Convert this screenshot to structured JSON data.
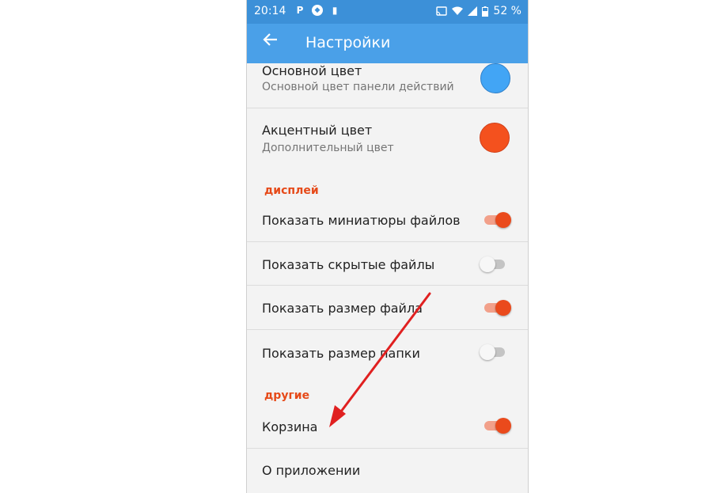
{
  "status_bar": {
    "time": "20:14",
    "left_icons": [
      "parking-icon",
      "compass-icon",
      "trash-icon"
    ],
    "right_icons": [
      "cast-icon",
      "wifi-icon",
      "signal-icon",
      "battery-icon"
    ],
    "battery": "52 %"
  },
  "toolbar": {
    "back_icon": "arrow-left-icon",
    "title": "Настройки"
  },
  "settings": {
    "primary_color": {
      "title": "Основной цвет",
      "subtitle": "Основной цвет панели действий",
      "color": "#42a5f5"
    },
    "accent_color": {
      "title": "Акцентный цвет",
      "subtitle": "Дополнительный цвет",
      "color": "#f4511e"
    },
    "display_section": "дисплей",
    "show_thumbnails": {
      "title": "Показать миниатюры файлов",
      "enabled": true
    },
    "show_hidden": {
      "title": "Показать скрытые файлы",
      "enabled": false
    },
    "show_file_size": {
      "title": "Показать размер файла",
      "enabled": true
    },
    "show_folder_size": {
      "title": "Показать размер папки",
      "enabled": false
    },
    "other_section": "другие",
    "trash": {
      "title": "Корзина",
      "enabled": true
    },
    "about": {
      "title": "О приложении"
    }
  },
  "colors": {
    "accent": "#e64a19",
    "toolbar": "#4aa0e8",
    "statusbar": "#3c90d8",
    "annotation_arrow": "#e02020"
  }
}
